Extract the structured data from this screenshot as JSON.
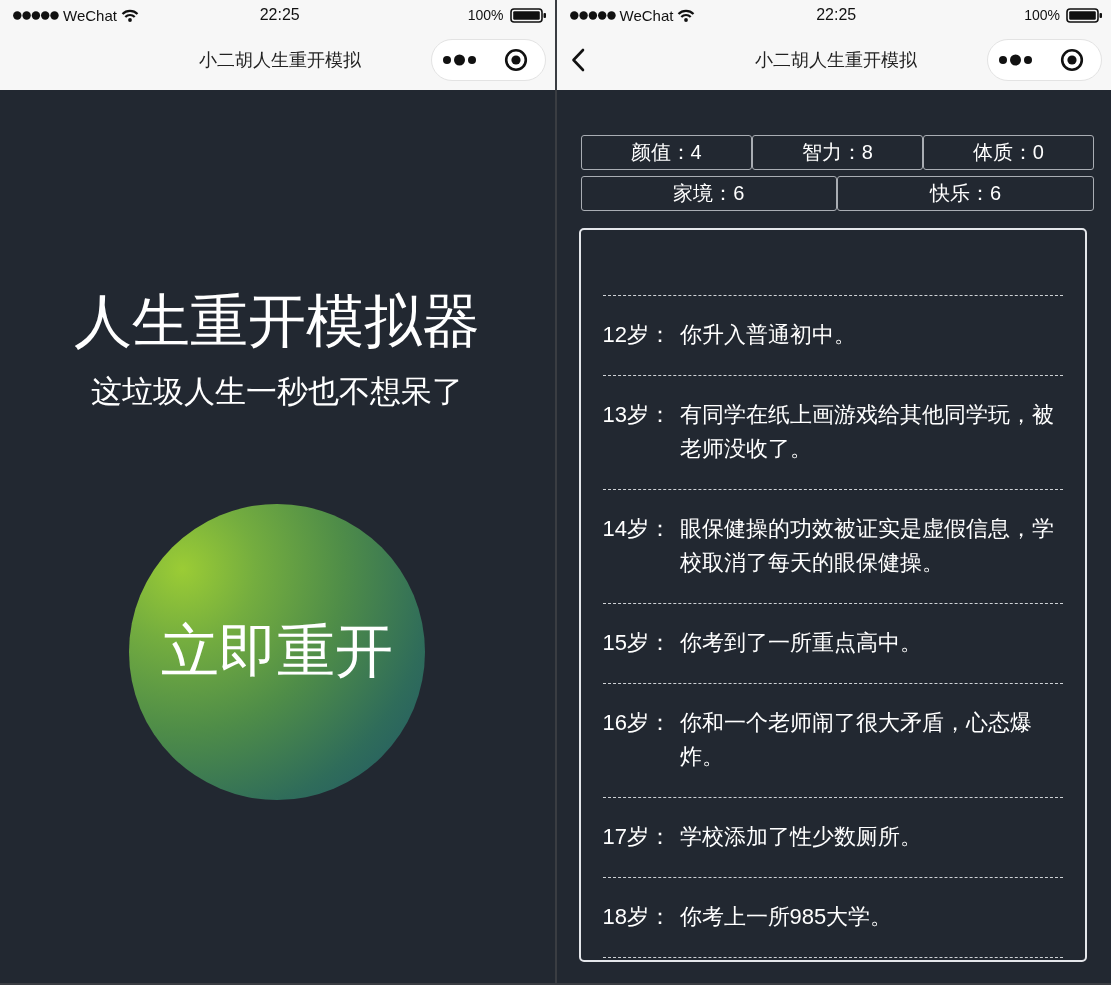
{
  "screens": [
    {
      "status_bar": {
        "carrier": "WeChat",
        "time": "22:25",
        "battery": "100%"
      },
      "nav_bar": {
        "back": false,
        "title": "小二胡人生重开模拟"
      },
      "content": {
        "kind": "home",
        "title": "人生重开模拟器",
        "subtitle": "这垃圾人生一秒也不想呆了",
        "button": "立即重开"
      }
    },
    {
      "status_bar": {
        "carrier": "WeChat",
        "time": "22:25",
        "battery": "100%"
      },
      "nav_bar": {
        "back": true,
        "title": "小二胡人生重开模拟"
      },
      "content": {
        "kind": "life",
        "stat_rows": [
          [
            "颜值：4",
            "智力：8",
            "体质：0"
          ],
          [
            "家境：6",
            "快乐：6"
          ]
        ],
        "events": [
          {
            "age": "12岁：",
            "text": "你升入普通初中。"
          },
          {
            "age": "13岁：",
            "text": "有同学在纸上画游戏给其他同学玩，被老师没收了。"
          },
          {
            "age": "14岁：",
            "text": "眼保健操的功效被证实是虚假信息，学校取消了每天的眼保健操。"
          },
          {
            "age": "15岁：",
            "text": "你考到了一所重点高中。"
          },
          {
            "age": "16岁：",
            "text": "你和一个老师闹了很大矛盾，心态爆炸。"
          },
          {
            "age": "17岁：",
            "text": "学校添加了性少数厕所。"
          },
          {
            "age": "18岁：",
            "text": "你考上一所985大学。"
          }
        ]
      }
    }
  ]
}
